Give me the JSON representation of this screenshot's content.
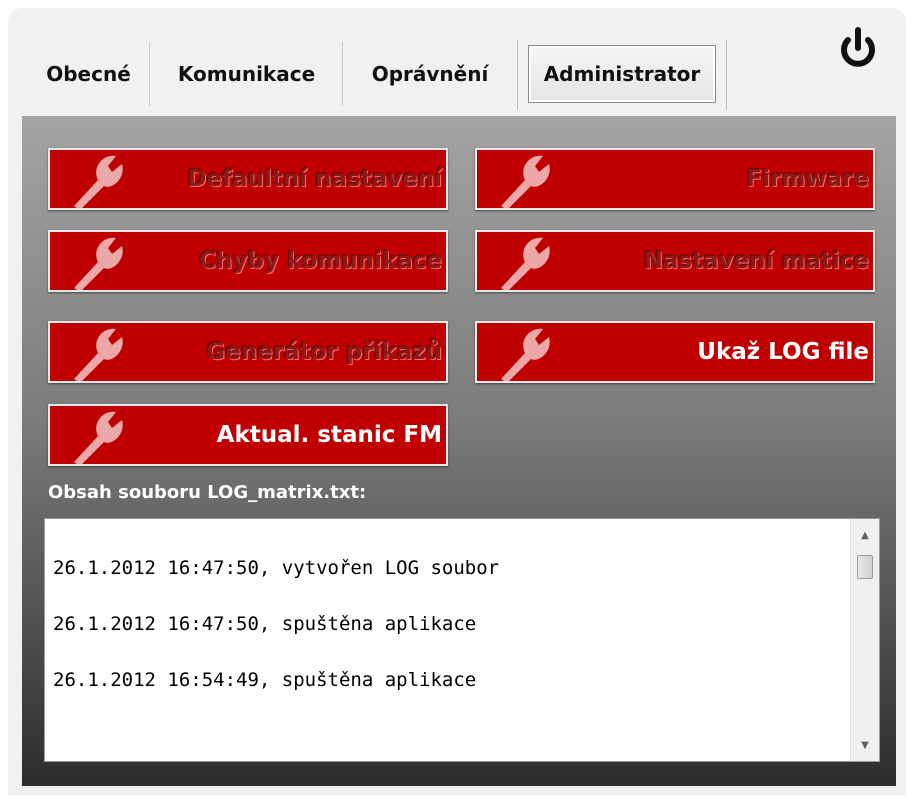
{
  "tabs": [
    {
      "label": "Obecné"
    },
    {
      "label": "Komunikace"
    },
    {
      "label": "Oprávnění"
    },
    {
      "label": "Administrator",
      "active": true
    }
  ],
  "icons": {
    "power": "power-icon",
    "wrench": "wrench-icon"
  },
  "colors": {
    "button_red": "#c00000",
    "button_text_enabled": "#ffffff",
    "button_text_disabled": "#8a1a1a"
  },
  "buttons": [
    {
      "label": "Defaultní nastavení",
      "enabled": false
    },
    {
      "label": "Firmware",
      "enabled": false
    },
    {
      "label": "Chyby komunikace",
      "enabled": false
    },
    {
      "label": "Nastavení matice",
      "enabled": false
    },
    {
      "label": "Generátor příkazů",
      "enabled": false
    },
    {
      "label": "Ukaž LOG file",
      "enabled": true
    },
    {
      "label": "Aktual. stanic FM",
      "enabled": true
    }
  ],
  "log": {
    "title": "Obsah souboru LOG_matrix.txt:",
    "lines": [
      "26.1.2012 16:47:50, vytvořen LOG soubor",
      "26.1.2012 16:47:50, spuštěna aplikace",
      "26.1.2012 16:54:49, spuštěna aplikace"
    ]
  }
}
